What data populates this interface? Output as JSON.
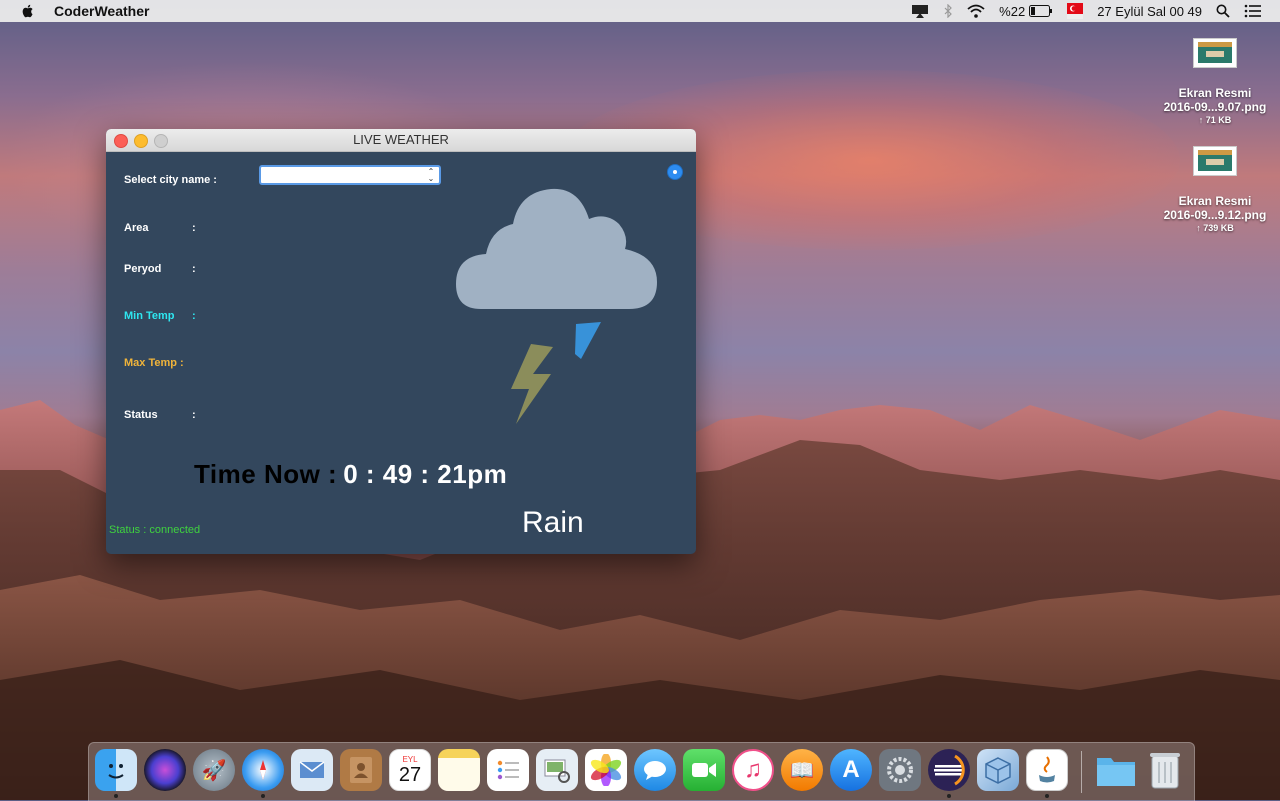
{
  "menubar": {
    "app_name": "CoderWeather",
    "battery_percent": "%22",
    "datetime": "27 Eylül Sal  00 49"
  },
  "desktop": {
    "files": [
      {
        "name_line1": "Ekran Resmi",
        "name_line2": "2016-09...9.07.png",
        "size": "↑ 71 KB"
      },
      {
        "name_line1": "Ekran Resmi",
        "name_line2": "2016-09...9.12.png",
        "size": "↑ 739 KB"
      }
    ]
  },
  "window": {
    "title": "LIVE WEATHER",
    "select_city_label": "Select city name :",
    "city_value": "",
    "fields": {
      "area": {
        "label": "Area",
        "colon": ":"
      },
      "peryod": {
        "label": "Peryod",
        "colon": ":"
      },
      "min_temp": {
        "label": "Min Temp",
        "colon": ":",
        "color": "#2ee6f0"
      },
      "max_temp": {
        "label": "Max Temp :",
        "color": "#f0b43a"
      },
      "status": {
        "label": "Status",
        "colon": ":"
      }
    },
    "time_label": "Time Now :",
    "time_value": "0 : 49 : 21pm",
    "weather_condition": "Rain",
    "connection_status": "Status : connected",
    "weather_icon": "cloud-storm-icon"
  },
  "dock": {
    "apps": [
      "finder-icon",
      "siri-icon",
      "launchpad-icon",
      "safari-icon",
      "mail-icon",
      "contacts-icon",
      "calendar-icon",
      "notes-icon",
      "reminders-icon",
      "preview-icon",
      "photos-icon",
      "messages-icon",
      "facetime-icon",
      "itunes-icon",
      "ibooks-icon",
      "app-store-icon",
      "system-preferences-icon",
      "eclipse-icon",
      "virtualbox-icon",
      "java-icon",
      "folder-icon",
      "trash-icon"
    ],
    "calendar_month": "EYL",
    "calendar_day": "27"
  }
}
